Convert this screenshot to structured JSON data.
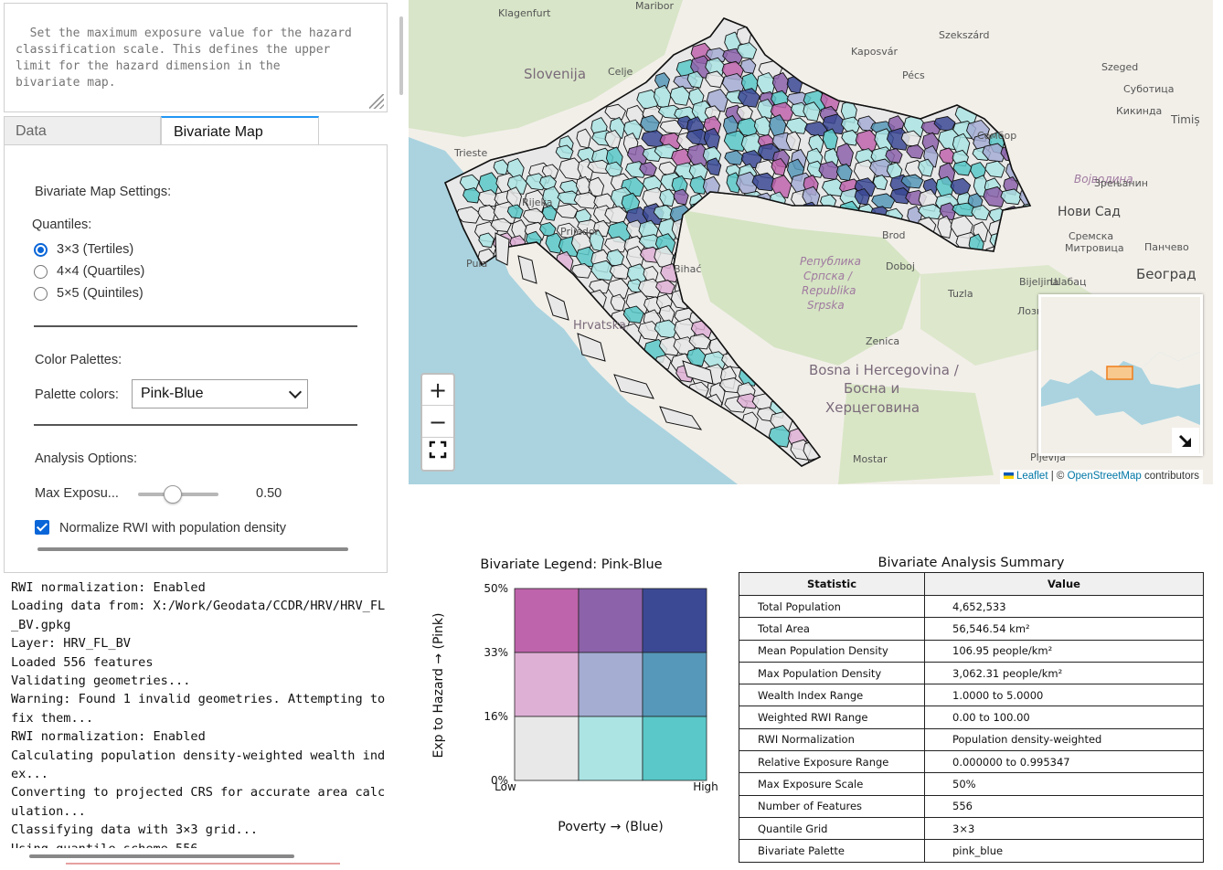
{
  "description": {
    "text": "Set the maximum exposure value for the hazard\nclassification scale. This defines the upper\nlimit for the hazard dimension in the\nbivariate map."
  },
  "tabs": [
    {
      "label": "Data",
      "active": false
    },
    {
      "label": "Bivariate Map",
      "active": true
    }
  ],
  "settings": {
    "title": "Bivariate Map Settings:",
    "quantiles_label": "Quantiles:",
    "quantile_options": [
      {
        "label": "3×3 (Tertiles)",
        "selected": true
      },
      {
        "label": "4×4 (Quartiles)",
        "selected": false
      },
      {
        "label": "5×5 (Quintiles)",
        "selected": false
      }
    ],
    "palettes_label": "Color Palettes:",
    "palette_colors_label": "Palette colors:",
    "palette_value": "Pink-Blue",
    "analysis_label": "Analysis Options:",
    "max_exposure_label": "Max Exposu...",
    "max_exposure_value": "0.50",
    "max_exposure_fraction": 0.5,
    "normalize_label": "Normalize RWI with population density",
    "normalize_checked": true
  },
  "log": {
    "lines": [
      "RWI normalization: Enabled",
      "Loading data from: X:/Work/Geodata/CCDR/HRV/HRV_FL",
      "_BV.gpkg",
      "Layer: HRV_FL_BV",
      "Loaded 556 features",
      "Validating geometries...",
      "Warning: Found 1 invalid geometries. Attempting to",
      "fix them...",
      "RWI normalization: Enabled",
      "Calculating population density-weighted wealth ind",
      "ex...",
      "Converting to projected CRS for accurate area calc",
      "ulation...",
      "Classifying data with 3×3 grid...",
      "Using quantile scheme 556"
    ]
  },
  "map": {
    "zoom_in": "+",
    "zoom_out": "−",
    "fullscreen_icon": "fullscreen-icon",
    "attribution": {
      "leaflet": "Leaflet",
      "sep": " | © ",
      "osm": "OpenStreetMap",
      "suffix": " contributors"
    },
    "place_labels": [
      {
        "text": "Klagenfurt",
        "cls": "city"
      },
      {
        "text": "Maribor",
        "cls": "city"
      },
      {
        "text": "Szekszárd",
        "cls": "city"
      },
      {
        "text": "Kaposvár",
        "cls": "city"
      },
      {
        "text": "Slovenija",
        "cls": "country"
      },
      {
        "text": "Celje",
        "cls": "city"
      },
      {
        "text": "Pécs",
        "cls": "city"
      },
      {
        "text": "Szeged",
        "cls": "city"
      },
      {
        "text": "Суботица",
        "cls": "city"
      },
      {
        "text": "Кикинда",
        "cls": "city"
      },
      {
        "text": "Timiș",
        "cls": "city"
      },
      {
        "text": "Сомбор",
        "cls": "city"
      },
      {
        "text": "Trieste",
        "cls": "city"
      },
      {
        "text": "Војводина",
        "cls": "region"
      },
      {
        "text": "Зрењанин",
        "cls": "city"
      },
      {
        "text": "Нови Сад",
        "cls": "big"
      },
      {
        "text": "Rijeka",
        "cls": "city"
      },
      {
        "text": "Prijedor",
        "cls": "city"
      },
      {
        "text": "Brod",
        "cls": "city"
      },
      {
        "text": "Сремска",
        "cls": "city"
      },
      {
        "text": "Митровица",
        "cls": "city"
      },
      {
        "text": "Панчево",
        "cls": "city"
      },
      {
        "text": "Београд",
        "cls": "big"
      },
      {
        "text": "Република",
        "cls": "region"
      },
      {
        "text": "Српска /",
        "cls": "region"
      },
      {
        "text": "Republika",
        "cls": "region"
      },
      {
        "text": "Srpska",
        "cls": "region"
      },
      {
        "text": "Doboj",
        "cls": "city"
      },
      {
        "text": "Bijeljina",
        "cls": "city"
      },
      {
        "text": "Шабац",
        "cls": "city"
      },
      {
        "text": "Tuzla",
        "cls": "city"
      },
      {
        "text": "Лозница",
        "cls": "city"
      },
      {
        "text": "Zenica",
        "cls": "city"
      },
      {
        "text": "Bosna i Hercegovina /",
        "cls": "country"
      },
      {
        "text": "Босна и",
        "cls": "country"
      },
      {
        "text": "Херцеговина",
        "cls": "country"
      },
      {
        "text": "Mostar",
        "cls": "city"
      },
      {
        "text": "Pljevlja",
        "cls": "city"
      },
      {
        "text": "Pula",
        "cls": "city"
      },
      {
        "text": "Hrvatska",
        "cls": "country"
      },
      {
        "text": "Bihać",
        "cls": "city"
      }
    ]
  },
  "legend": {
    "title": "Bivariate Legend: Pink-Blue",
    "ylabel": "Exp to Hazard → (Pink)",
    "xlabel": "Poverty → (Blue)",
    "y_ticks": [
      "50%",
      "33%",
      "16%",
      "0%"
    ],
    "x_ticks": [
      "Low",
      "High"
    ],
    "grid_colors": [
      [
        "#be64ac",
        "#8c62aa",
        "#3b4994"
      ],
      [
        "#dfb0d6",
        "#a5add3",
        "#5698b9"
      ],
      [
        "#e8e8e8",
        "#ace4e4",
        "#5ac8c8"
      ]
    ]
  },
  "summary": {
    "title": "Bivariate Analysis Summary",
    "headers": [
      "Statistic",
      "Value"
    ],
    "rows": [
      [
        "Total Population",
        "4,652,533"
      ],
      [
        "Total Area",
        "56,546.54 km²"
      ],
      [
        "Mean Population Density",
        "106.95 people/km²"
      ],
      [
        "Max Population Density",
        "3,062.31 people/km²"
      ],
      [
        "Wealth Index Range",
        "1.0000 to 5.0000"
      ],
      [
        "Weighted RWI Range",
        "0.00 to 100.00"
      ],
      [
        "RWI Normalization",
        "Population density-weighted"
      ],
      [
        "Relative Exposure Range",
        "0.000000 to 0.995347"
      ],
      [
        "Max Exposure Scale",
        "50%"
      ],
      [
        "Number of Features",
        "556"
      ],
      [
        "Quantile Grid",
        "3×3"
      ],
      [
        "Bivariate Palette",
        "pink_blue"
      ]
    ]
  }
}
